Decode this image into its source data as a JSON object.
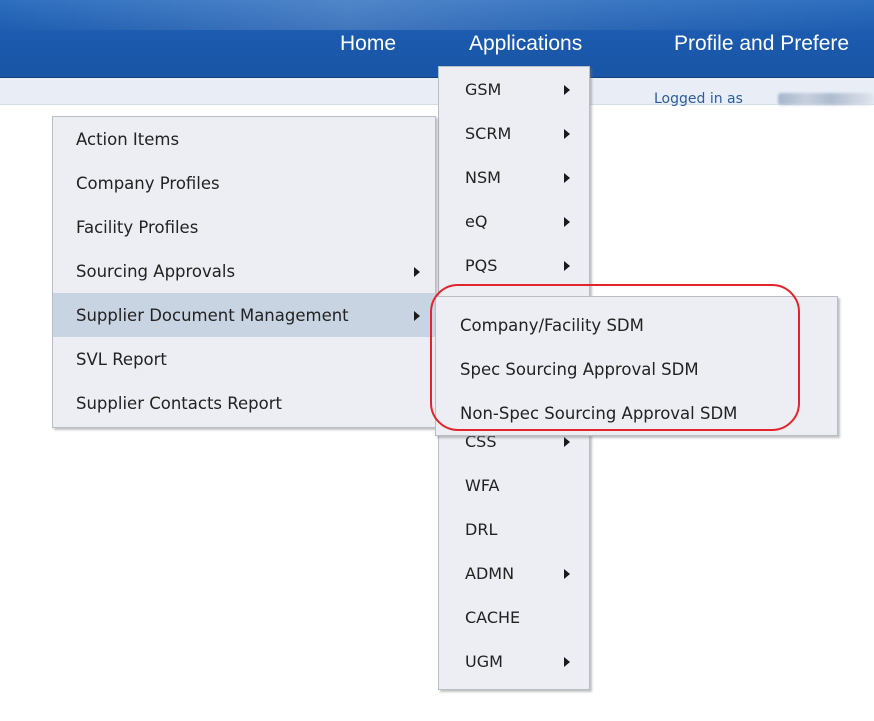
{
  "nav": {
    "home": "Home",
    "applications": "Applications",
    "profile": "Profile and Prefere"
  },
  "status": {
    "logged_in_label": "Logged in as"
  },
  "colors": {
    "nav_bar": "#1b5aae",
    "highlight_ring": "#e3242b",
    "active_item": "#c9d4e3"
  },
  "app_menu": {
    "items": [
      {
        "label": "GSM",
        "has_submenu": true
      },
      {
        "label": "SCRM",
        "has_submenu": true
      },
      {
        "label": "NSM",
        "has_submenu": true
      },
      {
        "label": "eQ",
        "has_submenu": true
      },
      {
        "label": "PQS",
        "has_submenu": true
      },
      {
        "label": "",
        "has_submenu": false
      },
      {
        "label": "",
        "has_submenu": false
      },
      {
        "label": "CSS",
        "has_submenu": true
      },
      {
        "label": "WFA",
        "has_submenu": false
      },
      {
        "label": "DRL",
        "has_submenu": false
      },
      {
        "label": "ADMN",
        "has_submenu": true
      },
      {
        "label": "CACHE",
        "has_submenu": false
      },
      {
        "label": "UGM",
        "has_submenu": true
      }
    ]
  },
  "left_menu": {
    "items": [
      {
        "label": "Action Items",
        "has_submenu": false
      },
      {
        "label": "Company Profiles",
        "has_submenu": false
      },
      {
        "label": "Facility Profiles",
        "has_submenu": false
      },
      {
        "label": "Sourcing Approvals",
        "has_submenu": true
      },
      {
        "label": "Supplier Document Management",
        "has_submenu": true,
        "active": true
      },
      {
        "label": "SVL Report",
        "has_submenu": false
      },
      {
        "label": "Supplier Contacts Report",
        "has_submenu": false
      }
    ]
  },
  "sub_menu": {
    "items": [
      {
        "label": "Company/Facility SDM"
      },
      {
        "label": "Spec Sourcing Approval SDM"
      },
      {
        "label": "Non-Spec Sourcing Approval SDM"
      }
    ]
  }
}
